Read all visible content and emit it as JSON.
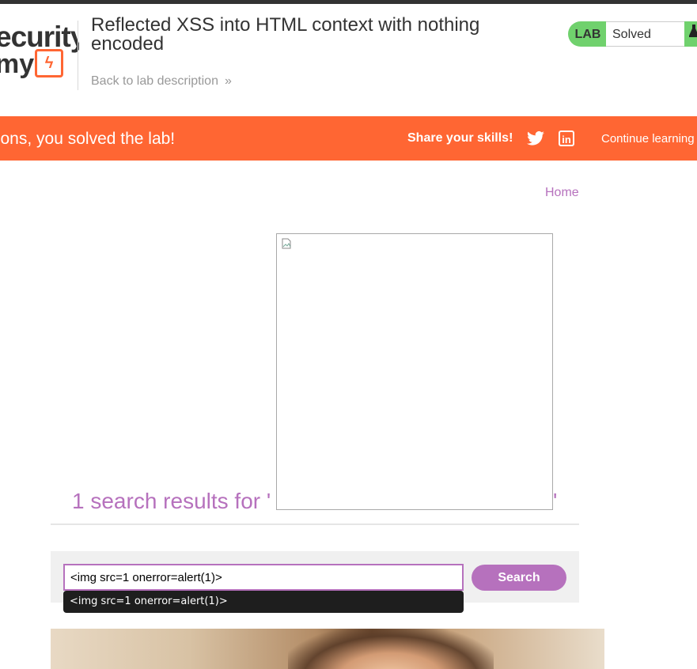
{
  "header": {
    "logo_line1": "ecurity",
    "logo_line2": "my",
    "title": "Reflected XSS into HTML context with nothing encoded",
    "back_link": "Back to lab description",
    "status_label": "LAB",
    "status_value": "Solved"
  },
  "banner": {
    "message": "tions, you solved the lab!",
    "share_label": "Share your skills!",
    "continue_label": "Continue learning"
  },
  "nav": {
    "home": "Home"
  },
  "search": {
    "results_heading": "1 search results for '",
    "results_quote_end": "'",
    "input_value": "<img src=1 onerror=alert(1)>",
    "button_label": "Search",
    "autocomplete_suggestion": "<img src=1 onerror=alert(1)>"
  },
  "colors": {
    "accent_orange": "#ff6633",
    "accent_purple": "#b671bd",
    "solved_green": "#70d16d"
  },
  "icons": [
    "twitter-icon",
    "linkedin-icon",
    "flask-icon",
    "chevron-double-right-icon",
    "broken-image-icon"
  ]
}
